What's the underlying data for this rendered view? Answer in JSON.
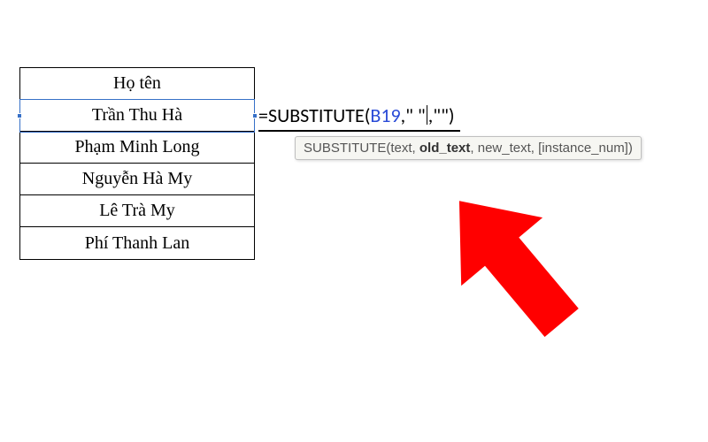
{
  "table": {
    "header": "Họ tên",
    "rows": [
      "Trần  Thu  Hà",
      "Phạm Minh Long",
      "Nguyễn Hà My",
      "Lê Trà My",
      "Phí Thanh Lan"
    ],
    "active_row_index": 0
  },
  "formula": {
    "equals": "=",
    "function": "SUBSTITUTE",
    "open_paren": "(",
    "ref": "B19",
    "comma1": ",",
    "arg1": "\" \"",
    "comma2": ",",
    "arg2": "\"\"",
    "close_paren": ")"
  },
  "tooltip": {
    "fn": "SUBSTITUTE(",
    "p1": "text",
    "sep1": ", ",
    "p2_bold": "old_text",
    "sep2": ", ",
    "p3": "new_text",
    "sep3": ", ",
    "p4": "[instance_num]",
    "close": ")"
  },
  "icons": {
    "arrow": "red-arrow-icon"
  }
}
